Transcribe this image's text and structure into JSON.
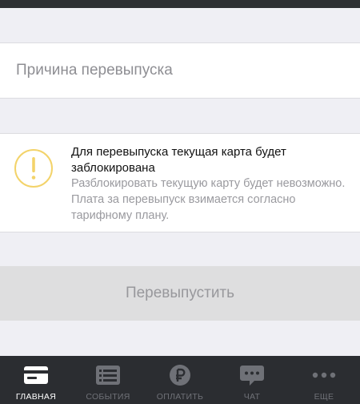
{
  "reason": {
    "placeholder": "Причина перевыпуска",
    "value": ""
  },
  "warning": {
    "icon": "warning-icon",
    "title": "Для перевыпуска текущая карта будет заблокирована",
    "text": "Разблокировать текущую карту будет невозможно. Плата за перевыпуск взимается согласно тарифному плану.",
    "accent": "#f3d36a"
  },
  "action": {
    "label": "Перевыпустить",
    "enabled": false
  },
  "tabbar": {
    "items": [
      {
        "label": "ГЛАВНАЯ",
        "icon": "card-icon",
        "active": true
      },
      {
        "label": "СОБЫТИЯ",
        "icon": "list-icon",
        "active": false
      },
      {
        "label": "ОПЛАТИТЬ",
        "icon": "ruble-icon",
        "active": false
      },
      {
        "label": "ЧАТ",
        "icon": "chat-icon",
        "active": false
      },
      {
        "label": "ЕЩЕ",
        "icon": "more-icon",
        "active": false
      }
    ]
  },
  "colors": {
    "background": "#efeff4",
    "tabbar_bg": "#2b2d31",
    "tab_active": "#ffffff",
    "tab_inactive": "#6f7177"
  }
}
